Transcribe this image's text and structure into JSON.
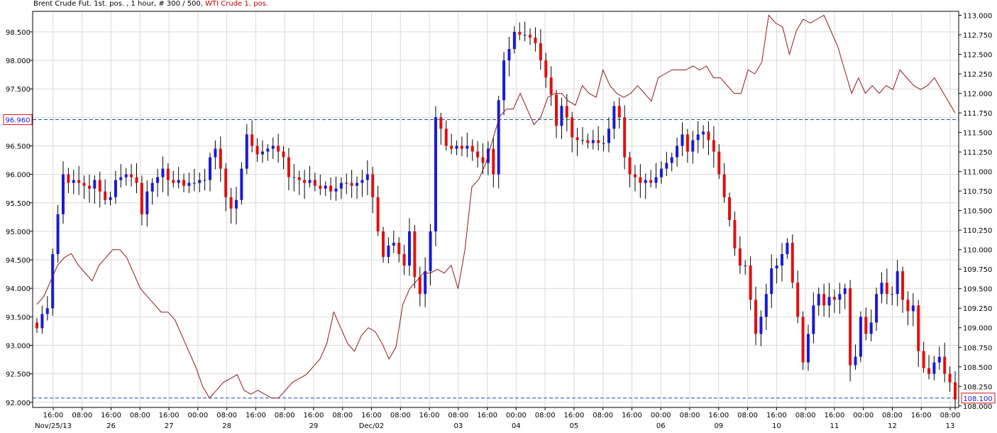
{
  "title": {
    "main": "Brent Crude Fut. 1st. pos. , 1 hour, # 300 / 500,",
    "second": "WTI Crude 1. pos."
  },
  "colors": {
    "up": "#1a1ad6",
    "down": "#e01010",
    "wick": "#000000",
    "line": "#8b1a1a",
    "grid": "#d9d9d9",
    "hline_left": "#0a5f7a",
    "hline_right": "#1a3fc9",
    "left_marker_border": "#e01010",
    "left_marker_text": "#1a1ad6",
    "right_marker_border": "#e01010",
    "right_marker_text": "#1a1ad6"
  },
  "chart_data": {
    "type": "candlestick+line",
    "y_left": {
      "ticks": [
        "92.000",
        "92.500",
        "93.000",
        "93.500",
        "94.000",
        "94.500",
        "95.000",
        "95.500",
        "96.000",
        "96.500",
        "97.000",
        "97.500",
        "98.000",
        "98.500"
      ],
      "min": 91.91,
      "max": 98.86
    },
    "y_right": {
      "ticks": [
        "108.000",
        "108.250",
        "108.500",
        "108.750",
        "109.000",
        "109.250",
        "109.500",
        "109.750",
        "110.000",
        "110.250",
        "110.500",
        "110.750",
        "111.000",
        "111.250",
        "111.500",
        "111.750",
        "112.000",
        "112.250",
        "112.500",
        "112.750",
        "113.000"
      ],
      "min": 107.98,
      "max": 113.05
    },
    "x_time_labels": [
      "16:00",
      "08:00",
      "16:00",
      "08:00",
      "16:00",
      "00:00",
      "08:00",
      "16:00",
      "08:00",
      "16:00",
      "08:00",
      "16:00",
      "08:00",
      "16:00",
      "08:00",
      "16:00",
      "00:00",
      "08:00",
      "16:00",
      "08:00",
      "16:00",
      "00:00",
      "08:00",
      "16:00",
      "08:00",
      "16:00",
      "08:00",
      "16:00",
      "00:00",
      "08:00",
      "16:00",
      "08:00"
    ],
    "x_date_labels": [
      "Nov/25/13",
      "26",
      "27",
      "28",
      "29",
      "Dec/02",
      "03",
      "04",
      "05",
      "06",
      "09",
      "10",
      "11",
      "12",
      "13"
    ],
    "markers": {
      "left_value": "96.960",
      "right_value": "108.100"
    },
    "brent_hourly_closes": [
      93.3,
      93.55,
      93.65,
      94.6,
      95.3,
      96.0,
      95.85,
      95.9,
      95.85,
      95.8,
      95.75,
      95.9,
      95.7,
      95.55,
      95.6,
      95.9,
      95.95,
      96.0,
      95.95,
      95.85,
      95.3,
      95.7,
      95.85,
      95.95,
      96.1,
      95.9,
      95.85,
      95.9,
      95.8,
      95.85,
      95.85,
      95.9,
      95.9,
      96.3,
      96.45,
      96.1,
      95.6,
      95.4,
      95.55,
      96.1,
      96.7,
      96.5,
      96.35,
      96.4,
      96.45,
      96.5,
      96.4,
      96.3,
      95.95,
      95.95,
      95.9,
      95.85,
      95.9,
      95.8,
      95.75,
      95.8,
      95.7,
      95.75,
      95.85,
      95.85,
      95.8,
      95.85,
      95.9,
      96.0,
      95.6,
      95.0,
      94.55,
      94.75,
      94.8,
      94.6,
      94.4,
      95.0,
      94.2,
      93.9,
      94.3,
      95.0,
      97.0,
      96.8,
      96.5,
      96.45,
      96.5,
      96.45,
      96.5,
      96.4,
      96.3,
      96.2,
      96.45,
      96.0,
      97.3,
      98.0,
      98.2,
      98.5,
      98.45,
      98.45,
      98.4,
      98.3,
      98.0,
      97.7,
      97.4,
      96.85,
      97.2,
      97.0,
      96.65,
      96.6,
      96.6,
      96.55,
      96.6,
      96.55,
      96.55,
      96.8,
      97.2,
      97.0,
      96.3,
      96.0,
      95.95,
      95.85,
      95.9,
      95.85,
      95.95,
      96.1,
      96.2,
      96.3,
      96.5,
      96.7,
      96.4,
      96.6,
      96.7,
      96.75,
      96.6,
      96.4,
      96.0,
      95.6,
      95.2,
      94.7,
      94.4,
      94.4,
      93.8,
      93.2,
      93.5,
      93.9,
      94.35,
      94.4,
      94.6,
      94.8,
      94.1,
      93.5,
      92.7,
      93.2,
      93.7,
      93.9,
      93.7,
      93.85,
      93.8,
      93.9,
      94.0,
      92.65,
      92.8,
      93.5,
      93.2,
      93.4,
      93.9,
      94.1,
      93.9,
      93.9,
      94.3,
      93.8,
      93.6,
      93.7,
      92.9,
      92.6,
      92.5,
      92.7,
      92.8,
      92.5,
      92.35,
      92.05
    ]
  }
}
